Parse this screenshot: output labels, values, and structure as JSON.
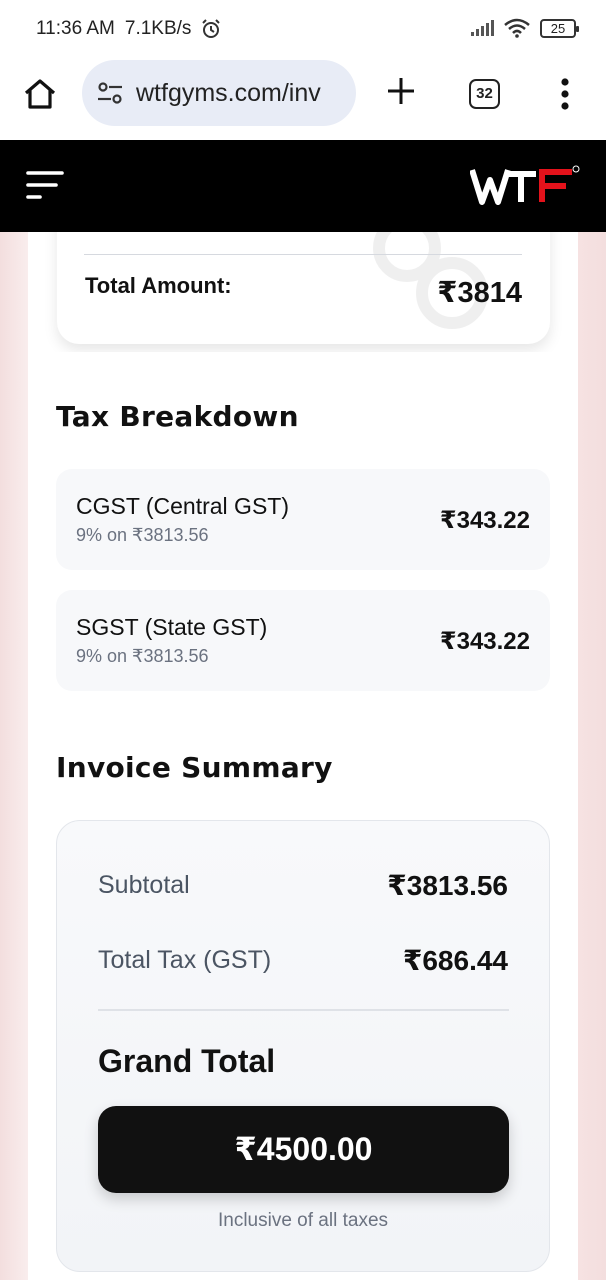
{
  "status_bar": {
    "time": "11:36 AM",
    "net_speed": "7.1KB/s",
    "battery": "25"
  },
  "browser": {
    "url": "wtfgyms.com/inv",
    "tab_count": "32",
    "icons": [
      "home-icon",
      "site-settings-icon",
      "plus-icon",
      "tabs-icon",
      "more-vert-icon"
    ]
  },
  "site": {
    "logo_text": "WTF",
    "logo_colors": {
      "primary": "#ffffff",
      "accent": "#e3121b"
    }
  },
  "order": {
    "total_label": "Total Amount:",
    "total_value": "₹3814"
  },
  "tax_breakdown": {
    "title": "Tax Breakdown",
    "rows": [
      {
        "name": "CGST (Central GST)",
        "sub": "9% on ₹3813.56",
        "amount": "₹343.22"
      },
      {
        "name": "SGST (State GST)",
        "sub": "9% on ₹3813.56",
        "amount": "₹343.22"
      }
    ]
  },
  "invoice_summary": {
    "title": "Invoice Summary",
    "subtotal_label": "Subtotal",
    "subtotal_value": "₹3813.56",
    "tax_label": "Total Tax (GST)",
    "tax_value": "₹686.44",
    "grand_label": "Grand Total",
    "grand_value": "₹4500.00",
    "note": "Inclusive of all taxes"
  }
}
